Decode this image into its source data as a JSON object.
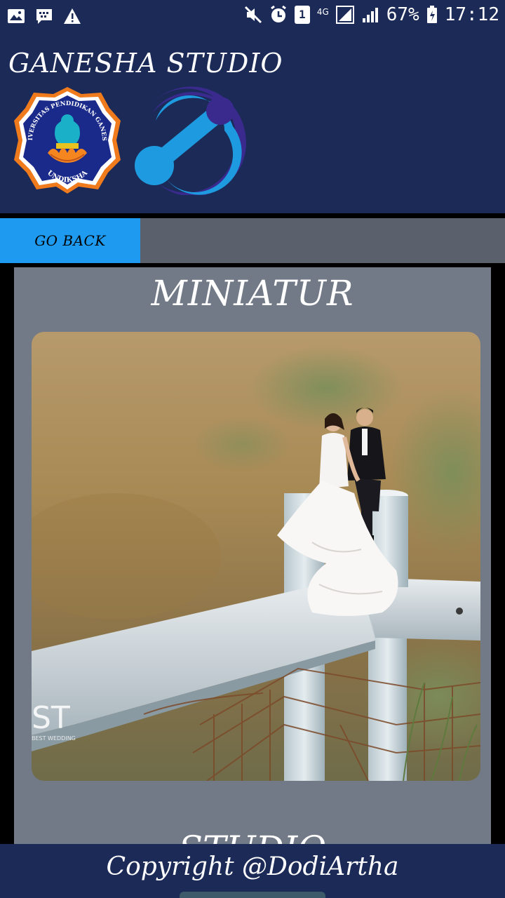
{
  "status_bar": {
    "network": "4G",
    "battery": "67%",
    "time": "17:12",
    "notification_badge": "1",
    "icons": [
      "image-icon",
      "bbm-icon",
      "warning-icon",
      "mute-icon",
      "alarm-icon",
      "sim-icon",
      "signal-icon",
      "wifi-signal-icon",
      "battery-icon"
    ]
  },
  "header": {
    "title": "GANESHA STUDIO",
    "logo_text_top": "UNIVERSITAS PENDIDIKAN GANESHA",
    "logo_text_bottom": "UNDIKSHA"
  },
  "nav": {
    "go_back_label": "GO BACK"
  },
  "content": {
    "section_title": "MINIATUR",
    "next_section_title": "STUDIO",
    "photo_watermark": "ST",
    "photo_caption": "BEST WEDDING"
  },
  "footer": {
    "copyright": "Copyright @DodiArtha"
  },
  "colors": {
    "header_bg": "#1b2a57",
    "go_back_bg": "#1e9bf0",
    "nav_bg": "#5a616c",
    "content_bg": "#727a87"
  }
}
